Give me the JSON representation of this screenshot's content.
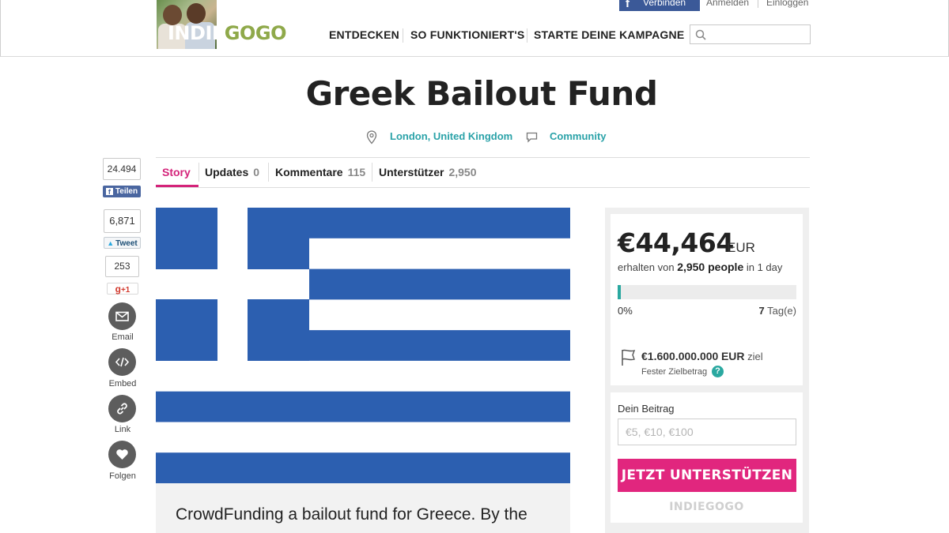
{
  "header": {
    "logo_left": "INDIE",
    "logo_right": "GOGO",
    "fb_connect_label": "Verbinden",
    "signin_label": "Anmelden",
    "login_label": "Einloggen",
    "nav": [
      "ENTDECKEN",
      "SO FUNKTIONIERT'S",
      "STARTE DEINE KAMPAGNE"
    ],
    "search_placeholder": ""
  },
  "campaign": {
    "title": "Greek Bailout Fund",
    "location": "London, United Kingdom",
    "category": "Community"
  },
  "tabs": [
    {
      "label": "Story",
      "count": ""
    },
    {
      "label": "Updates",
      "count": "0"
    },
    {
      "label": "Kommentare",
      "count": "115"
    },
    {
      "label": "Unterstützer",
      "count": "2,950"
    }
  ],
  "share": {
    "facebook_count": "24.494",
    "facebook_label": "Teilen",
    "twitter_count": "6,871",
    "twitter_label": "Tweet",
    "gplus_count": "253",
    "gplus_label": "+1",
    "email_label": "Email",
    "embed_label": "Embed",
    "link_label": "Link",
    "follow_label": "Folgen"
  },
  "story": {
    "intro": "CrowdFunding a bailout fund for Greece. By the"
  },
  "funding": {
    "amount": "€44,464",
    "currency": "EUR",
    "raised_prefix": "erhalten von",
    "backers": "2,950 people",
    "raised_suffix": "in 1 day",
    "progress_percent": 1.8,
    "percent_label": "0%",
    "days_left": "7",
    "days_unit": "Tag(e)",
    "goal_amount": "€1.600.000.000",
    "goal_currency": "EUR",
    "goal_suffix": "ziel",
    "fixed_label": "Fester Zielbetrag",
    "help_symbol": "?"
  },
  "contribute": {
    "label": "Dein Beitrag",
    "placeholder": "€5, €10, €100",
    "button_label": "JETZT UNTERSTÜTZEN",
    "footer_logo": "INDIEGOGO"
  },
  "colors": {
    "accent_pink": "#d4237a",
    "teal": "#2aa8a0",
    "flag_blue": "#2c5fb0"
  }
}
